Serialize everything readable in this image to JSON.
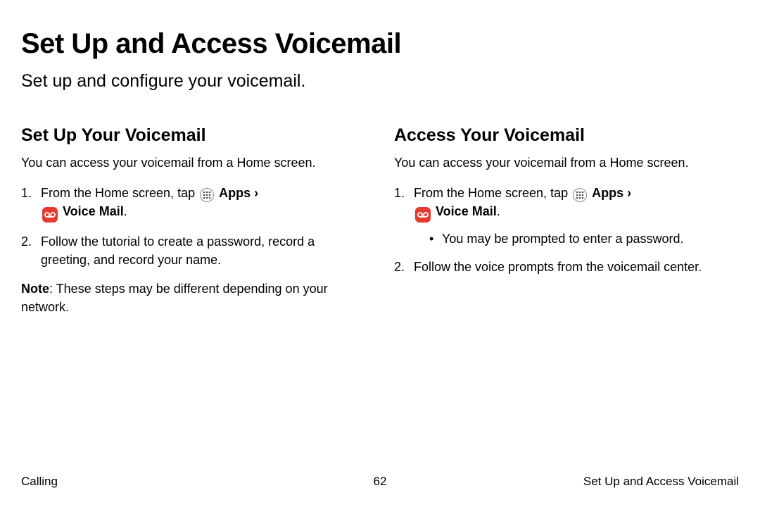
{
  "page": {
    "title": "Set Up and Access Voicemail",
    "subtitle": "Set up and configure your voicemail."
  },
  "left": {
    "heading": "Set Up Your Voicemail",
    "intro": "You can access your voicemail from a Home screen.",
    "step1_pre": "From the Home screen, tap ",
    "apps_label": "Apps",
    "chevron": "›",
    "voicemail_label": "Voice Mail",
    "period": ".",
    "step2": "Follow the tutorial to create a password, record a greeting, and record your name.",
    "note_bold": "Note",
    "note_rest": ": These steps may be different depending on your network."
  },
  "right": {
    "heading": "Access Your Voicemail",
    "intro": "You can access your voicemail from a Home screen.",
    "step1_pre": "From the Home screen, tap ",
    "apps_label": "Apps",
    "chevron": "›",
    "voicemail_label": "Voice Mail",
    "period": ".",
    "bullet1": "You may be prompted to enter a password.",
    "step2": "Follow the voice prompts from the voicemail center."
  },
  "footer": {
    "left": "Calling",
    "center": "62",
    "right": "Set Up and Access Voicemail"
  }
}
